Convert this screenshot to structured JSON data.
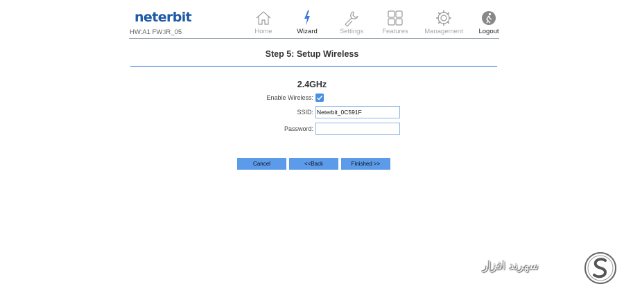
{
  "header": {
    "logo": "neterbit",
    "hw_fw": "HW:A1 FW:IR_05",
    "nav": [
      {
        "label": "Home",
        "icon": "home-icon"
      },
      {
        "label": "Wizard",
        "icon": "lightning-icon",
        "active": true
      },
      {
        "label": "Settings",
        "icon": "wrench-icon"
      },
      {
        "label": "Features",
        "icon": "grid-icon"
      },
      {
        "label": "Management",
        "icon": "gear-icon"
      },
      {
        "label": "Logout",
        "icon": "logout-icon"
      }
    ]
  },
  "wizard": {
    "step_title": "Step 5: Setup Wireless",
    "band_title": "2.4GHz",
    "enable_label": "Enable Wireless:",
    "enable_checked": true,
    "ssid_label": "SSID:",
    "ssid_value": "Neterbit_0C591F",
    "password_label": "Password:",
    "password_value": ""
  },
  "buttons": {
    "cancel": "Cancel",
    "back": "<<Back",
    "finished": "Finished >>"
  },
  "colors": {
    "brand_blue": "#1f5aa6",
    "accent_blue": "#5b9be9",
    "checkbox_blue": "#4a90e2",
    "divider_blue": "#8fb5e6"
  },
  "watermark": {
    "text": "سهرند افزار",
    "logo_icon": "s-logo-icon"
  }
}
